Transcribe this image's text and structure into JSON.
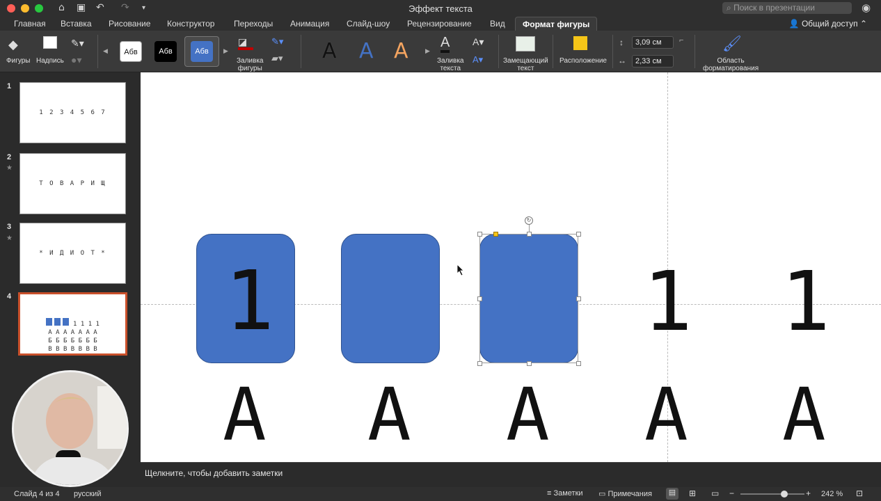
{
  "window": {
    "title": "Эффект текста",
    "search_placeholder": "Поиск в презентации"
  },
  "tabs": [
    {
      "label": "Главная"
    },
    {
      "label": "Вставка"
    },
    {
      "label": "Рисование"
    },
    {
      "label": "Конструктор"
    },
    {
      "label": "Переходы"
    },
    {
      "label": "Анимация"
    },
    {
      "label": "Слайд-шоу"
    },
    {
      "label": "Рецензирование"
    },
    {
      "label": "Вид"
    },
    {
      "label": "Формат фигуры"
    }
  ],
  "share_label": "Общий доступ",
  "ribbon": {
    "shapes": "Фигуры",
    "textbox": "Надпись",
    "style_label": "Абв",
    "fill_shape": "Заливка\nфигуры",
    "fill_text": "Заливка\nтекста",
    "placeholder_text": "Замещающий\nтекст",
    "arrange": "Расположение",
    "format_pane": "Область\nформатирования",
    "height": "3,09 см",
    "width": "2,33 см",
    "wordart_letter": "A"
  },
  "slides": [
    {
      "num": "1",
      "text": "1 2 3 4 5 6 7"
    },
    {
      "num": "2",
      "text": "Т О В А Р И Щ"
    },
    {
      "num": "3",
      "text": "* И Д И О Т *"
    },
    {
      "num": "4",
      "row1": "1 1 1 1",
      "row2": "А А А А А А А",
      "row3": "Б Б Б Б Б Б Б",
      "row4": "В В В В В В В"
    }
  ],
  "canvas": {
    "one": "1",
    "letter_a": "А"
  },
  "notes_placeholder": "Щелкните, чтобы добавить заметки",
  "status": {
    "slide": "Слайд 4 из 4",
    "lang": "русский",
    "notes": "Заметки",
    "comments": "Примечания",
    "zoom": "242 %"
  },
  "colors": {
    "accent": "#4472c4",
    "thumb_selected": "#c9502b"
  }
}
